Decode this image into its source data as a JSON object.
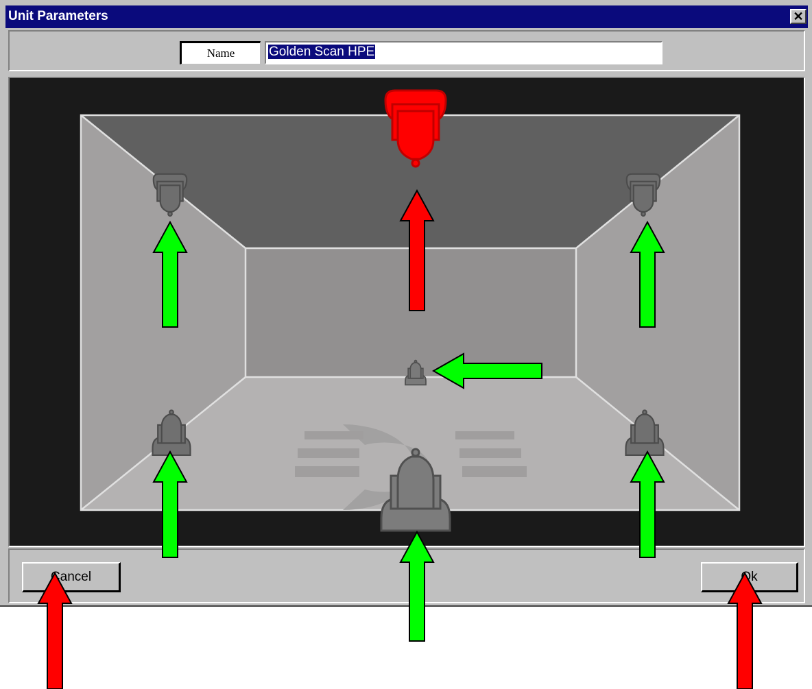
{
  "window": {
    "title": "Unit Parameters",
    "close_label": "✕"
  },
  "name_field": {
    "label": "Name",
    "value": "Golden Scan HPE"
  },
  "buttons": {
    "cancel_label": "Cancel",
    "ok_label": "Ok"
  },
  "colors": {
    "titlebar": "#0a0a7c",
    "selected_fixture": "#ff0000",
    "arrow_green": "#00ff00",
    "arrow_red": "#ff0000"
  },
  "stage": {
    "fixtures": [
      {
        "id": "ceiling-center",
        "selected": true,
        "icon": "hanging-scanner-icon"
      },
      {
        "id": "ceiling-left",
        "selected": false,
        "icon": "hanging-scanner-icon"
      },
      {
        "id": "ceiling-right",
        "selected": false,
        "icon": "hanging-scanner-icon"
      },
      {
        "id": "back-center",
        "selected": false,
        "icon": "standing-scanner-icon"
      },
      {
        "id": "floor-left",
        "selected": false,
        "icon": "standing-scanner-icon"
      },
      {
        "id": "floor-right",
        "selected": false,
        "icon": "standing-scanner-icon"
      },
      {
        "id": "floor-front",
        "selected": false,
        "icon": "standing-scanner-icon"
      }
    ]
  }
}
